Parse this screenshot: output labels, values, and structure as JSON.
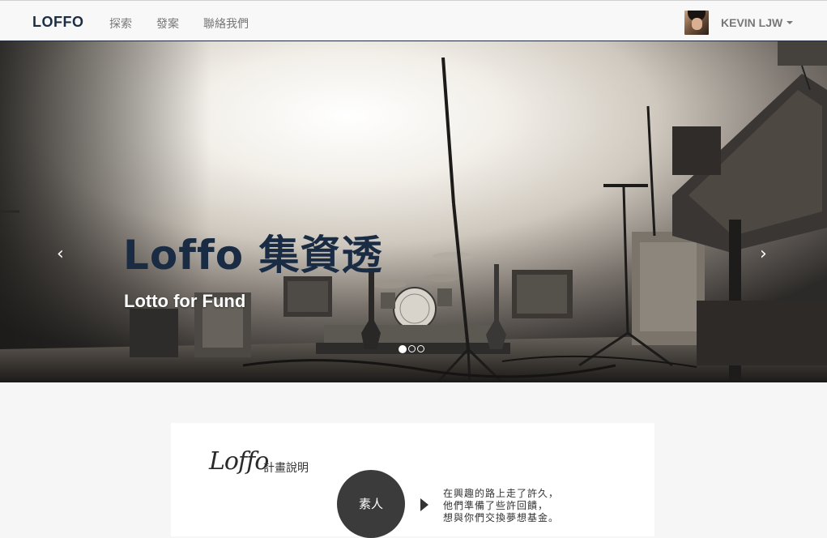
{
  "navbar": {
    "brand": "LOFFO",
    "links": [
      "探索",
      "發案",
      "聯絡我們"
    ],
    "user": "KEVIN LJW"
  },
  "hero": {
    "title": "Loffo 集資透",
    "subtitle": "Lotto for Fund",
    "prev_icon": "‹",
    "next_icon": "›",
    "slides_count": 3,
    "active_slide": 1
  },
  "intro": {
    "logo_text": "Loffo",
    "plan_label": "計畫說明",
    "circle_label": "素人",
    "description": [
      "在興趣的路上走了許久，",
      "他們準備了些許回饋，",
      "想與你們交換夢想基金。"
    ]
  },
  "colors": {
    "brand": "#1c2e44",
    "nav_text": "#777777",
    "navbar_bg": "#f8f8f8"
  }
}
